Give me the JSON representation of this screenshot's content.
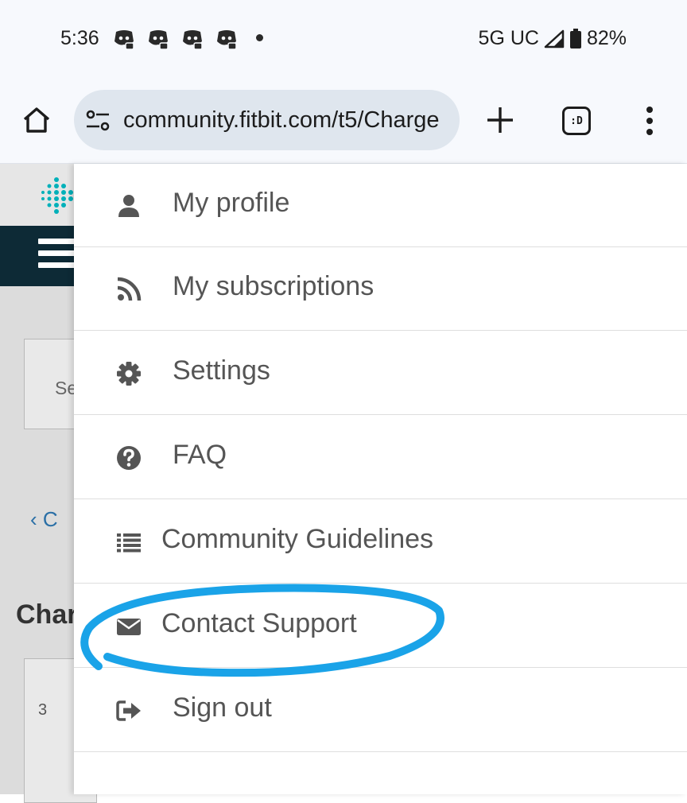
{
  "status_bar": {
    "time": "5:36",
    "network": "5G UC",
    "battery": "82%",
    "notification_icons": [
      "discord-icon",
      "discord-icon",
      "discord-icon",
      "discord-icon"
    ]
  },
  "browser": {
    "url": "community.fitbit.com/t5/Charge",
    "tab_counter": ":D"
  },
  "background_page": {
    "search_hint": "Se",
    "back_link": "C",
    "heading": "Char",
    "card_text": "3"
  },
  "menu": {
    "items": [
      {
        "label": "My profile",
        "icon": "user-icon"
      },
      {
        "label": "My subscriptions",
        "icon": "rss-icon"
      },
      {
        "label": "Settings",
        "icon": "gear-icon"
      },
      {
        "label": "FAQ",
        "icon": "question-circle-icon"
      },
      {
        "label": "Community Guidelines",
        "icon": "list-icon"
      },
      {
        "label": "Contact Support",
        "icon": "envelope-icon"
      },
      {
        "label": "Sign out",
        "icon": "sign-out-icon"
      }
    ]
  },
  "colors": {
    "highlight_annotation": "#1aa3e8",
    "nav_bar": "#0d2a36",
    "menu_text": "#555555",
    "brand_accent": "#00b0b9"
  }
}
